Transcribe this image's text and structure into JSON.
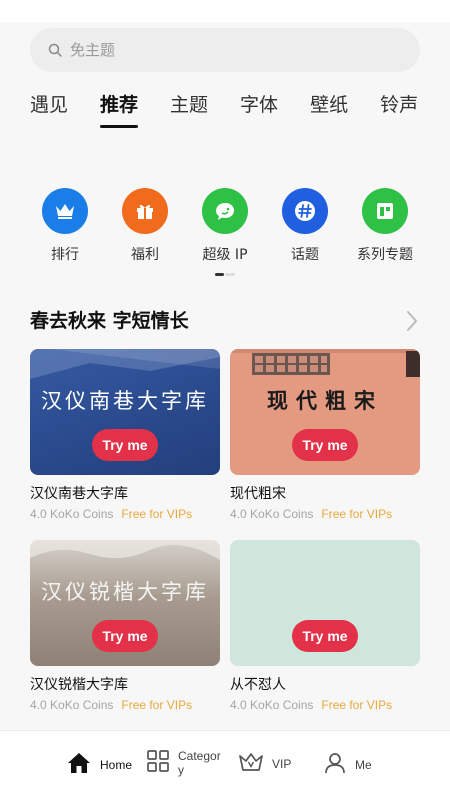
{
  "search": {
    "placeholder": "免主题"
  },
  "tabs": [
    {
      "label": "遇见"
    },
    {
      "label": "推荐",
      "active": true
    },
    {
      "label": "主题"
    },
    {
      "label": "字体"
    },
    {
      "label": "壁纸"
    },
    {
      "label": "铃声"
    }
  ],
  "quick_links": [
    {
      "label": "排行",
      "icon": "crown-icon",
      "color": "#1b7ee8"
    },
    {
      "label": "福利",
      "icon": "gift-icon",
      "color": "#f06b1c"
    },
    {
      "label": "超级 IP",
      "icon": "chat-bubble-icon",
      "color": "#2fc145"
    },
    {
      "label": "话题",
      "icon": "hashtag-icon",
      "color": "#1f5fe0"
    },
    {
      "label": "系列专题",
      "icon": "layout-icon",
      "color": "#2fc145"
    }
  ],
  "section": {
    "title": "春去秋来 字短情长"
  },
  "cards": [
    {
      "preview_text": "汉仪南巷大字库",
      "name": "汉仪南巷大字库",
      "price": "4.0 KoKo Coins",
      "vip": "Free for VIPs",
      "try": "Try me",
      "bg": "#2b4d93",
      "text_color": "#ffffff"
    },
    {
      "preview_text": "现代粗宋",
      "name": "现代粗宋",
      "price": "4.0 KoKo Coins",
      "vip": "Free for VIPs",
      "try": "Try me",
      "bg": "#e39a80",
      "text_color": "#1a1a1a"
    },
    {
      "preview_text": "汉仪锐楷大字库",
      "name": "汉仪锐楷大字库",
      "price": "4.0 KoKo Coins",
      "vip": "Free for VIPs",
      "try": "Try me",
      "bg": "#9c8f83",
      "text_color": "#f2f2f2"
    },
    {
      "preview_text": "",
      "name": "从不怼人",
      "price": "4.0 KoKo Coins",
      "vip": "Free for VIPs",
      "try": "Try me",
      "bg": "#cfe6dd",
      "text_color": "#333333"
    }
  ],
  "bottom_nav": [
    {
      "label": "Home",
      "icon": "home-icon"
    },
    {
      "label": "Category",
      "icon": "grid-icon"
    },
    {
      "label": "VIP",
      "icon": "vip-crown-icon"
    },
    {
      "label": "Me",
      "icon": "user-icon"
    }
  ]
}
